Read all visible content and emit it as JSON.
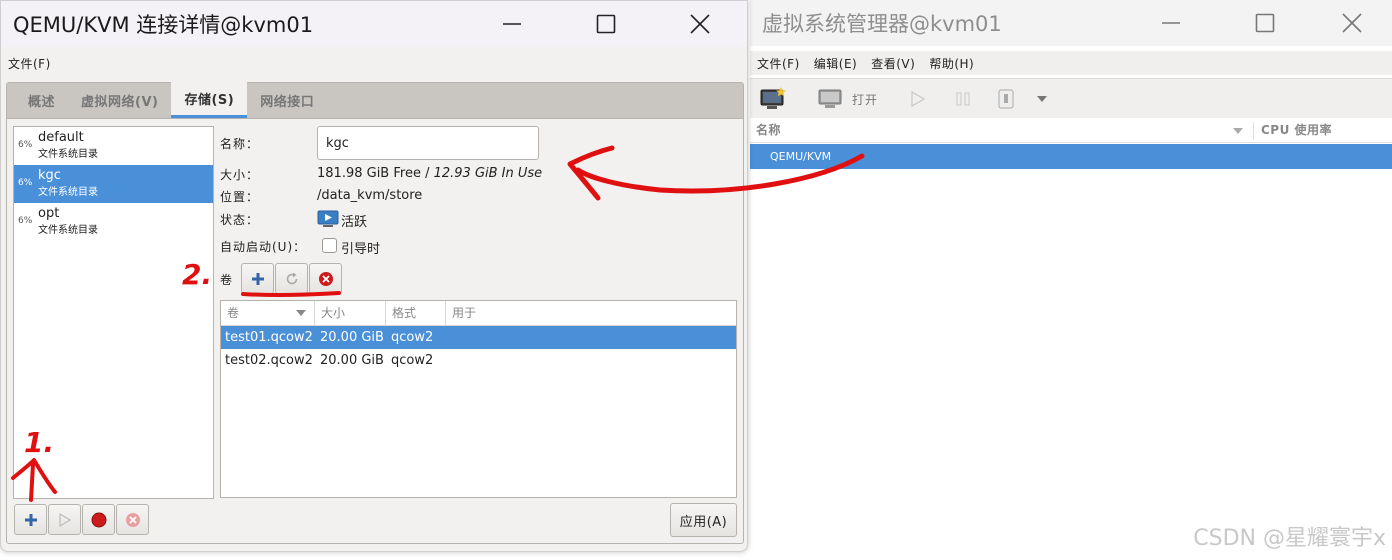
{
  "details_window": {
    "title": "QEMU/KVM 连接详情@kvm01",
    "menu": [
      "文件(F)"
    ],
    "tabs": [
      "概述",
      "虚拟网络(V)",
      "存储(S)",
      "网络接口"
    ],
    "active_tab": 2,
    "pools": [
      {
        "percent": "6%",
        "name": "default",
        "type": "文件系统目录",
        "selected": false
      },
      {
        "percent": "6%",
        "name": "kgc",
        "type": "文件系统目录",
        "selected": true
      },
      {
        "percent": "6%",
        "name": "opt",
        "type": "文件系统目录",
        "selected": false
      }
    ],
    "labels": {
      "name": "名称：",
      "size": "大小：",
      "location": "位置：",
      "state": "状态：",
      "autostart": "自动启动(U)：",
      "volumes": "卷"
    },
    "values": {
      "name": "kgc",
      "size_free": "181.98 GiB Free / ",
      "size_used": "12.93 GiB In Use",
      "location": "/data_kvm/store",
      "state": "活跃",
      "autostart": "引导时",
      "autostart_checked": false
    },
    "volume_columns": [
      "卷",
      "大小",
      "格式",
      "用于"
    ],
    "volumes": [
      {
        "name": "test01.qcow2",
        "size": "20.00 GiB",
        "format": "qcow2",
        "used_by": "",
        "selected": true
      },
      {
        "name": "test02.qcow2",
        "size": "20.00 GiB",
        "format": "qcow2",
        "used_by": "",
        "selected": false
      }
    ],
    "apply_label": "应用(A)"
  },
  "manager_window": {
    "title": "虚拟系统管理器@kvm01",
    "menu": [
      "文件(F)",
      "编辑(E)",
      "查看(V)",
      "帮助(H)"
    ],
    "toolbar_open_label": "打开",
    "columns": [
      "名称",
      "CPU 使用率"
    ],
    "rows": [
      "QEMU/KVM"
    ]
  },
  "annotations": {
    "label_1": "1.",
    "label_2": "2.",
    "color": "#e01010"
  },
  "watermark": "CSDN @星耀寰宇x",
  "colors": {
    "selection": "#4a90d9",
    "window_bg": "#f2f1f0",
    "tab_active_underline": "#4a90d9"
  }
}
